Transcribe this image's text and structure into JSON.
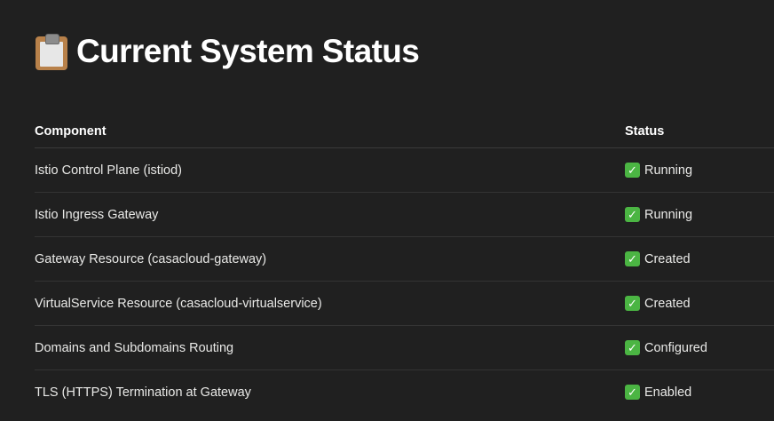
{
  "page": {
    "heading": "Current System Status",
    "heading_icon": "clipboard-icon"
  },
  "table": {
    "headers": [
      "Component",
      "Status"
    ],
    "rows": [
      {
        "component": "Istio Control Plane (istiod)",
        "status": "Running"
      },
      {
        "component": "Istio Ingress Gateway",
        "status": "Running"
      },
      {
        "component": "Gateway Resource (casacloud-gateway)",
        "status": "Created"
      },
      {
        "component": "VirtualService Resource (casacloud-virtualservice)",
        "status": "Created"
      },
      {
        "component": "Domains and Subdomains Routing",
        "status": "Configured"
      },
      {
        "component": "TLS (HTTPS) Termination at Gateway",
        "status": "Enabled"
      }
    ],
    "status_icon": "check-mark-icon",
    "status_icon_color": "#4bb543"
  },
  "colors": {
    "background": "#202020",
    "text": "#e9e9e7",
    "divider": "#343434"
  }
}
